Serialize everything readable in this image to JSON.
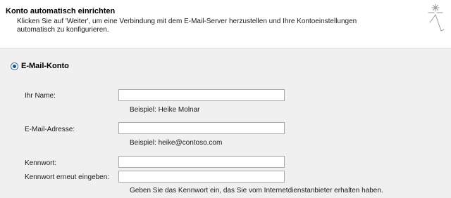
{
  "header": {
    "title": "Konto automatisch einrichten",
    "description": "Klicken Sie auf 'Weiter', um eine Verbindung mit dem E-Mail-Server herzustellen und Ihre Kontoeinstellungen automatisch zu konfigurieren.",
    "icon": "sparkle-wand-icon"
  },
  "account_option": {
    "label": "E-Mail-Konto",
    "selected": true
  },
  "form": {
    "name_label": "Ihr Name:",
    "name_value": "",
    "name_hint": "Beispiel: Heike Molnar",
    "email_label": "E-Mail-Adresse:",
    "email_value": "",
    "email_hint": "Beispiel: heike@contoso.com",
    "password_label": "Kennwort:",
    "password_value": "",
    "password_repeat_label": "Kennwort erneut eingeben:",
    "password_repeat_value": "",
    "password_hint": "Geben Sie das Kennwort ein, das Sie vom Internetdienstanbieter erhalten haben."
  }
}
